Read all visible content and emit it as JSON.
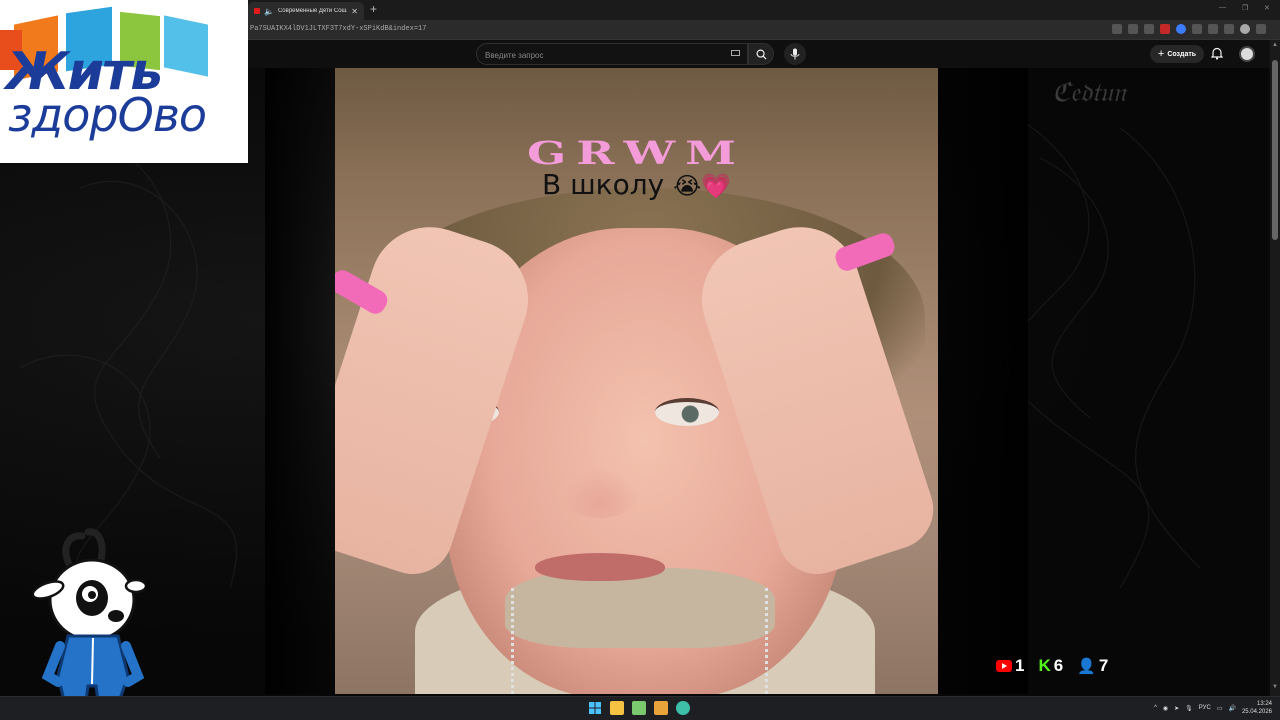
{
  "browser": {
    "tab_title": "Современные Дети Сошли с",
    "url": "Pa7SUAIKX4lDV1JLTXF3T7xdY-xSPiKdB&index=17",
    "new_tab_symbol": "+"
  },
  "youtube": {
    "search_placeholder": "Введите запрос",
    "create_label": "Создать"
  },
  "video": {
    "overlay_title": "GRWM",
    "caption": "В  школу",
    "caption_emojis": "😭💗"
  },
  "overlay_logo": {
    "line1": "Жить",
    "line2": "здорОво"
  },
  "stream_counters": {
    "youtube_viewers": "1",
    "kick_viewers": "6",
    "total_viewers": "7"
  },
  "taskbar": {
    "language": "РУС",
    "time": "13:24",
    "date": "25.04.2026"
  },
  "colors": {
    "grwm_pink": "#f49bd9",
    "youtube_red": "#ff0000",
    "kick_green": "#53fc18",
    "logo_blue": "#1c3c9a"
  }
}
